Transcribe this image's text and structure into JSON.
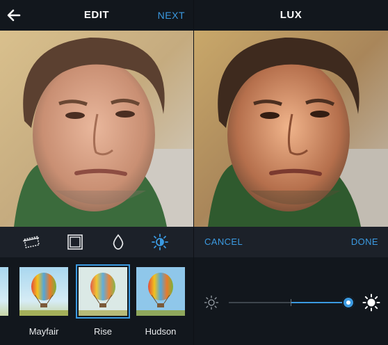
{
  "edit_screen": {
    "title": "EDIT",
    "next_label": "NEXT",
    "tools": [
      "crop-icon",
      "frame-icon",
      "drop-icon",
      "sun-icon"
    ],
    "active_tool": "sun-icon",
    "filters": [
      {
        "label": "Mayfair",
        "selected": false
      },
      {
        "label": "Rise",
        "selected": true
      },
      {
        "label": "Hudson",
        "selected": false
      }
    ]
  },
  "lux_screen": {
    "title": "LUX",
    "cancel_label": "CANCEL",
    "done_label": "DONE",
    "slider_value": 1.0
  },
  "colors": {
    "accent": "#3b9ae1",
    "topbar": "#12171d",
    "panel": "#1c2129"
  }
}
